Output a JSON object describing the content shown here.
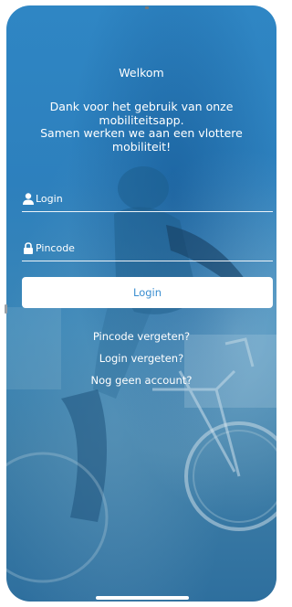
{
  "welcome": {
    "title": "Welkom",
    "lines": [
      "Dank voor het gebruik van onze",
      "mobiliteitsapp.",
      "Samen werken we aan een vlottere",
      "mobiliteit!"
    ]
  },
  "form": {
    "login_placeholder": "Login",
    "login_icon": "user-icon",
    "pin_placeholder": "Pincode",
    "pin_icon": "lock-icon",
    "submit_label": "Login"
  },
  "links": {
    "forgot_pin": "Pincode vergeten?",
    "forgot_login": "Login vergeten?",
    "no_account": "Nog geen account?"
  },
  "colors": {
    "background_overlay": "#2f86c4",
    "button_background": "#ffffff",
    "button_text": "#3a8ed0",
    "text": "#ffffff"
  }
}
